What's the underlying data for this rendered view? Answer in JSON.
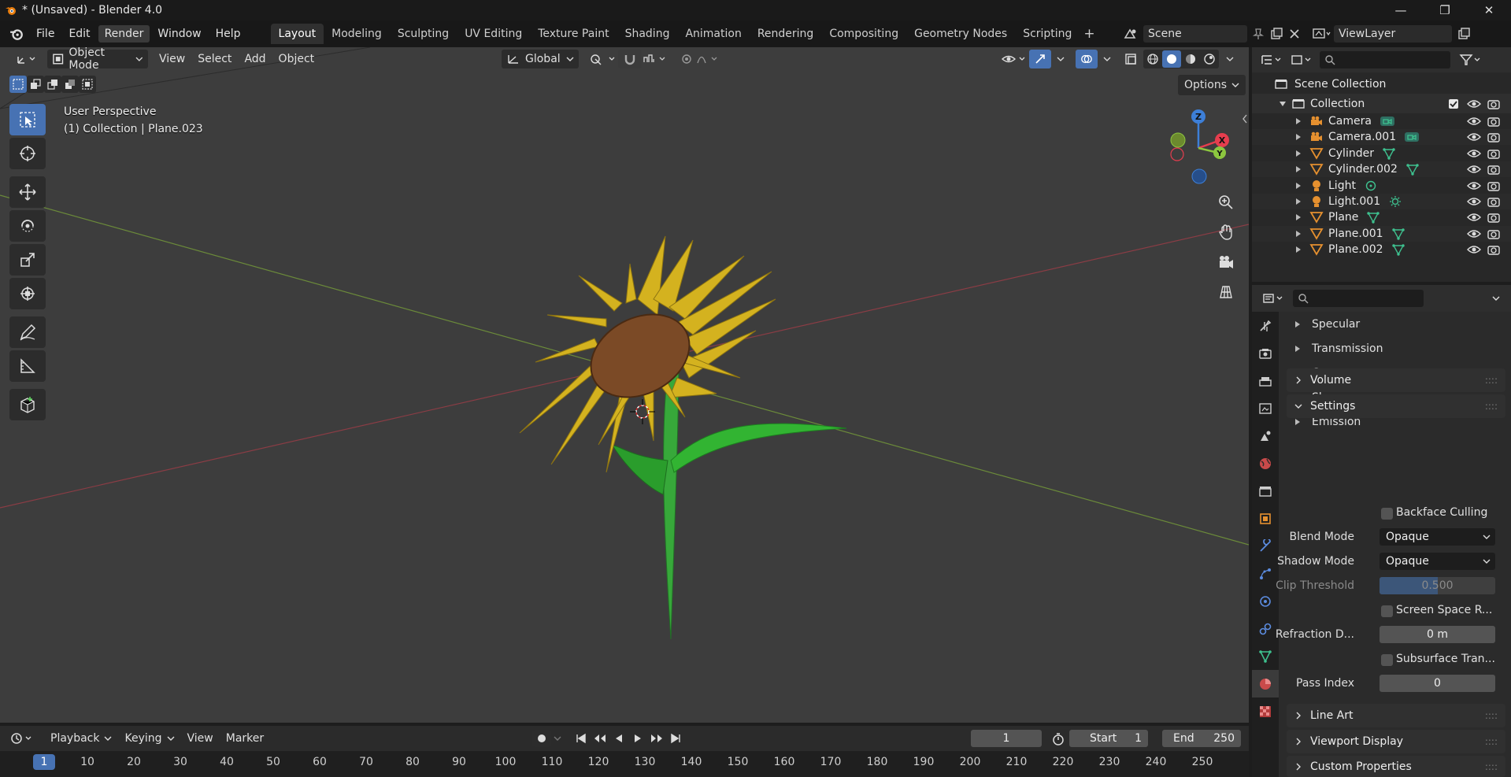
{
  "titlebar": {
    "title": "* (Unsaved) - Blender 4.0",
    "minimize": "—",
    "maximize": "❐",
    "close": "✕"
  },
  "menu": [
    "File",
    "Edit",
    "Render",
    "Window",
    "Help"
  ],
  "workspaces": [
    "Layout",
    "Modeling",
    "Sculpting",
    "UV Editing",
    "Texture Paint",
    "Shading",
    "Animation",
    "Rendering",
    "Compositing",
    "Geometry Nodes",
    "Scripting"
  ],
  "scene": {
    "name": "Scene",
    "view_layer": "ViewLayer"
  },
  "viewport": {
    "mode": "Object Mode",
    "menus": [
      "View",
      "Select",
      "Add",
      "Object"
    ],
    "orientation": "Global",
    "options": "Options",
    "info_line1": "User Perspective",
    "info_line2": "(1) Collection | Plane.023",
    "gizmo": {
      "z": "Z",
      "x": "X",
      "y": "Y"
    }
  },
  "outliner": {
    "root": "Scene Collection",
    "collection": "Collection",
    "items": [
      {
        "name": "Camera",
        "type": "camera"
      },
      {
        "name": "Camera.001",
        "type": "camera"
      },
      {
        "name": "Cylinder",
        "type": "mesh"
      },
      {
        "name": "Cylinder.002",
        "type": "mesh"
      },
      {
        "name": "Light",
        "type": "light"
      },
      {
        "name": "Light.001",
        "type": "sun"
      },
      {
        "name": "Plane",
        "type": "mesh"
      },
      {
        "name": "Plane.001",
        "type": "mesh"
      },
      {
        "name": "Plane.002",
        "type": "mesh"
      }
    ]
  },
  "properties": {
    "subpanels": [
      "Specular",
      "Transmission",
      "Coat",
      "Sheen",
      "Emission"
    ],
    "panels": {
      "volume": "Volume",
      "settings": "Settings",
      "line_art": "Line Art",
      "viewport_display": "Viewport Display",
      "custom_properties": "Custom Properties"
    },
    "backface_culling": "Backface Culling",
    "blend_mode_label": "Blend Mode",
    "blend_mode": "Opaque",
    "shadow_mode_label": "Shadow Mode",
    "shadow_mode": "Opaque",
    "clip_threshold_label": "Clip Threshold",
    "clip_threshold": "0.500",
    "screen_space": "Screen Space R...",
    "refraction_label": "Refraction D...",
    "refraction": "0 m",
    "subsurface": "Subsurface Tran...",
    "pass_index_label": "Pass Index",
    "pass_index": "0"
  },
  "timeline": {
    "menus": [
      "Playback",
      "Keying",
      "View",
      "Marker"
    ],
    "current_frame": "1",
    "start_label": "Start",
    "start": "1",
    "end_label": "End",
    "end": "250",
    "ticks": [
      "1",
      "10",
      "20",
      "30",
      "40",
      "50",
      "60",
      "70",
      "80",
      "90",
      "100",
      "110",
      "120",
      "130",
      "140",
      "150",
      "160",
      "170",
      "180",
      "190",
      "200",
      "210",
      "220",
      "230",
      "240",
      "250"
    ]
  },
  "colors": {
    "accent": "#4772b3",
    "mesh_icon": "#3ec18f",
    "object_icon": "#e5902f",
    "x_axis": "#e63d4e",
    "y_axis": "#8cc63f",
    "z_axis": "#3d7fd8"
  }
}
